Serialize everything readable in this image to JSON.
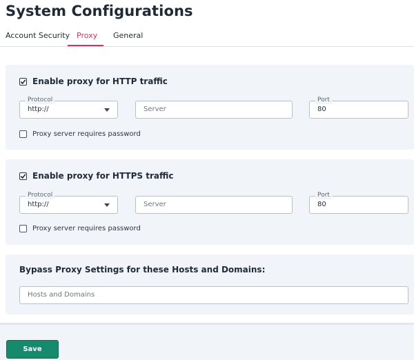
{
  "page_title": "System Configurations",
  "tabs": [
    {
      "label": "Account Security",
      "active": false
    },
    {
      "label": "Proxy",
      "active": true
    },
    {
      "label": "General",
      "active": false
    }
  ],
  "colors": {
    "accent": "#d0345e",
    "panel_bg": "#f1f4f8",
    "save_button": "#178a6e"
  },
  "http_proxy": {
    "enable_label": "Enable proxy for HTTP traffic",
    "enabled": true,
    "protocol_legend": "Protocol",
    "protocol_value": "http://",
    "server_placeholder": "Server",
    "port_legend": "Port",
    "port_value": "80",
    "password_label": "Proxy server requires password",
    "password_required": false
  },
  "https_proxy": {
    "enable_label": "Enable proxy for HTTPS traffic",
    "enabled": true,
    "protocol_legend": "Protocol",
    "protocol_value": "http://",
    "server_placeholder": "Server",
    "port_legend": "Port",
    "port_value": "80",
    "password_label": "Proxy server requires password",
    "password_required": false
  },
  "bypass": {
    "heading": "Bypass Proxy Settings for these Hosts and Domains:",
    "placeholder": "Hosts and Domains"
  },
  "footer": {
    "save_label": "Save"
  }
}
